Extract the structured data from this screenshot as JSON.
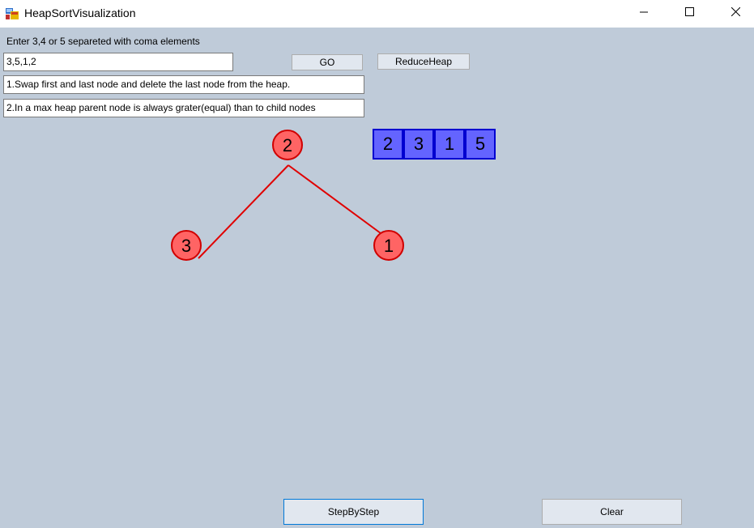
{
  "window": {
    "title": "HeapSortVisualization",
    "icons": [
      "app-icon",
      "minimize-icon",
      "maximize-icon",
      "close-icon"
    ]
  },
  "form": {
    "prompt_label": "Enter 3,4 or 5 separeted with coma elements",
    "input_value": "3,5,1,2",
    "go_label": "GO",
    "reduce_heap_label": "ReduceHeap",
    "step1_text": "1.Swap first and last node and delete the last node from the heap.",
    "step2_text": "2.In a max heap parent node is always grater(equal) than to child nodes",
    "step_by_step_label": "StepByStep",
    "clear_label": "Clear"
  },
  "heap_tree": {
    "nodes": [
      {
        "value": "2",
        "role": "root"
      },
      {
        "value": "3",
        "role": "left-child"
      },
      {
        "value": "1",
        "role": "right-child"
      }
    ]
  },
  "array": [
    "2",
    "3",
    "1",
    "5"
  ],
  "colors": {
    "client_bg": "#bfcbd9",
    "node_fill": "#ff6464",
    "node_stroke": "#d00000",
    "edge": "#e00000",
    "array_fill": "#6464ff",
    "array_border": "#0000d0"
  }
}
